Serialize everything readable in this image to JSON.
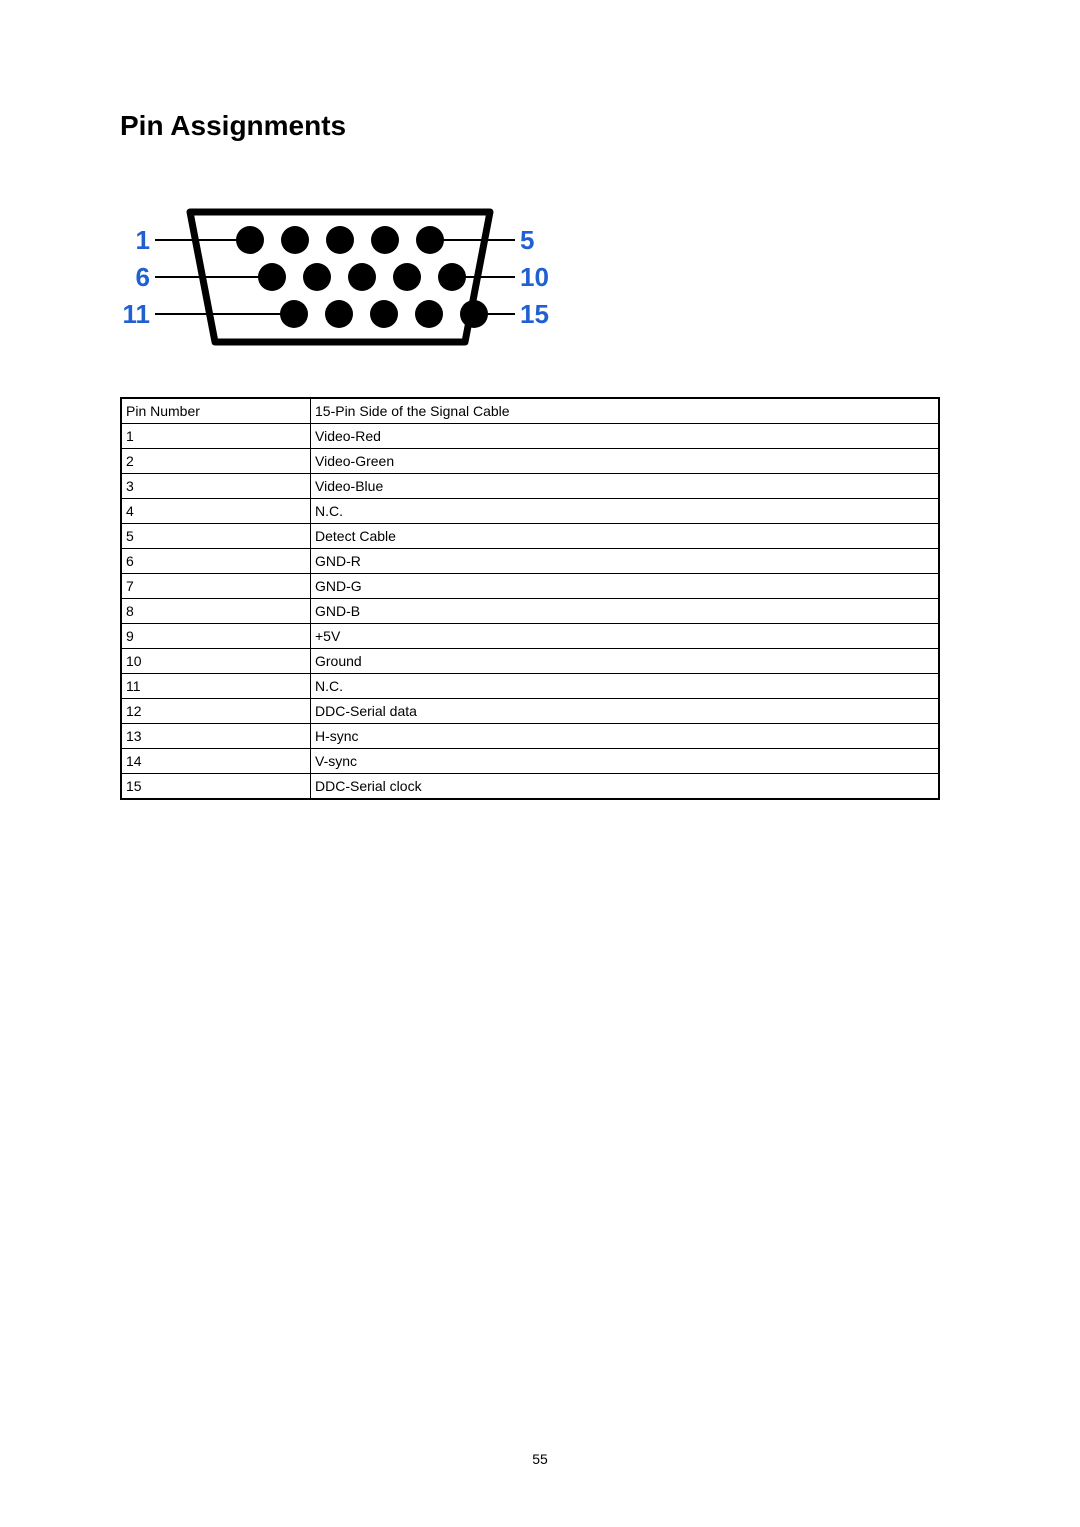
{
  "title": "Pin Assignments",
  "diagram": {
    "label_top_left": "1",
    "label_top_right": "5",
    "label_mid_left": "6",
    "label_mid_right": "10",
    "label_bot_left": "11",
    "label_bot_right": "15"
  },
  "table": {
    "header_col1": "Pin Number",
    "header_col2": "15-Pin Side of the Signal Cable",
    "rows": [
      {
        "num": "1",
        "desc": "Video-Red"
      },
      {
        "num": "2",
        "desc": "Video-Green"
      },
      {
        "num": "3",
        "desc": "Video-Blue"
      },
      {
        "num": "4",
        "desc": "N.C."
      },
      {
        "num": "5",
        "desc": "Detect Cable"
      },
      {
        "num": "6",
        "desc": "GND-R"
      },
      {
        "num": "7",
        "desc": "GND-G"
      },
      {
        "num": "8",
        "desc": "GND-B"
      },
      {
        "num": "9",
        "desc": "+5V"
      },
      {
        "num": "10",
        "desc": "Ground"
      },
      {
        "num": "11",
        "desc": "N.C."
      },
      {
        "num": "12",
        "desc": "DDC-Serial data"
      },
      {
        "num": "13",
        "desc": "H-sync"
      },
      {
        "num": "14",
        "desc": "V-sync"
      },
      {
        "num": "15",
        "desc": "DDC-Serial clock"
      }
    ]
  },
  "page_number": "55"
}
